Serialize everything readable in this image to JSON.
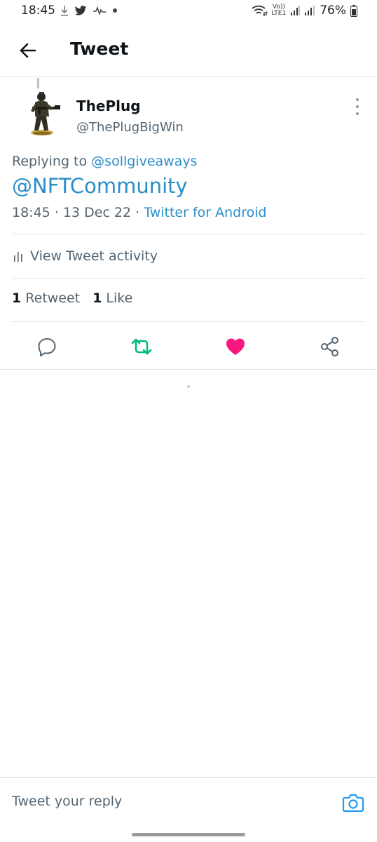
{
  "status_bar": {
    "time": "18:45",
    "battery": "76%",
    "lte_top": "Vo))",
    "lte_bottom": "LTE1",
    "icons": [
      "download-icon",
      "twitter-icon",
      "audio-wave-icon",
      "dot-icon",
      "wifi-icon",
      "signal-icon",
      "battery-icon"
    ]
  },
  "header": {
    "title": "Tweet"
  },
  "tweet": {
    "display_name": "ThePlug",
    "handle": "@ThePlugBigWin",
    "replying_prefix": "Replying to",
    "replying_to": "@sollgiveaways",
    "text": "@NFTCommunity",
    "time": "18:45",
    "date": "13 Dec 22",
    "source": "Twitter for Android",
    "separator": "·"
  },
  "activity": {
    "label": "View Tweet activity"
  },
  "stats": {
    "retweet_count": "1",
    "retweet_label": "Retweet",
    "like_count": "1",
    "like_label": "Like"
  },
  "actions": {
    "reply_color": "#536471",
    "retweet_color": "#00ba7c",
    "like_color": "#f91880",
    "share_color": "#536471"
  },
  "reply_bar": {
    "placeholder": "Tweet your reply",
    "accent": "#1d9bf0"
  }
}
